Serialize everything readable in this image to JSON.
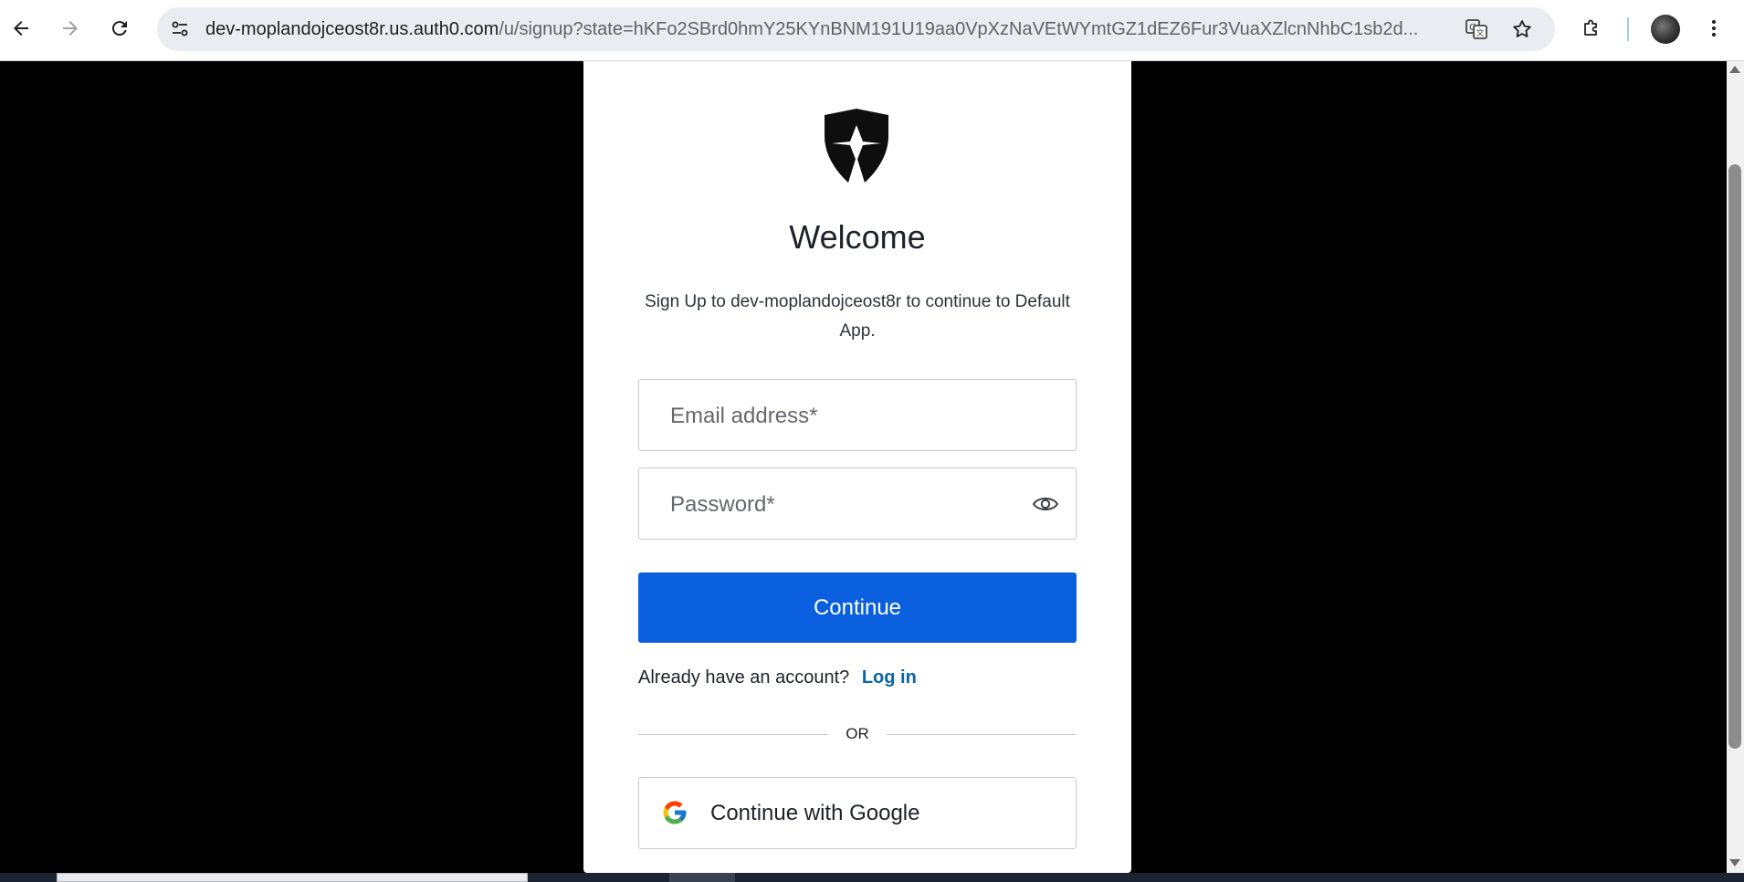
{
  "browser": {
    "url_host": "dev-moplandojceost8r.us.auth0.com",
    "url_path": "/u/signup?state=hKFo2SBrd0hmY25KYnBNM191U19aa0VpXzNaVEtWYmtGZ1dEZ6Fur3VuaXZlcnNhbC1sb2d...",
    "icons": [
      "back-icon",
      "forward-icon",
      "reload-icon",
      "site-info-icon",
      "translate-icon",
      "star-icon",
      "extensions-icon",
      "profile-avatar",
      "menu-icon"
    ]
  },
  "signup": {
    "title": "Welcome",
    "subtitle": "Sign Up to dev-moplandojceost8r to continue to Default App.",
    "email_placeholder": "Email address*",
    "password_placeholder": "Password*",
    "continue_label": "Continue",
    "login_prompt": "Already have an account?",
    "login_link": "Log in",
    "divider_label": "OR",
    "google_label": "Continue with Google"
  },
  "colors": {
    "primary": "#0a5fde",
    "link": "#0a64a8",
    "page_background": "#000000"
  }
}
